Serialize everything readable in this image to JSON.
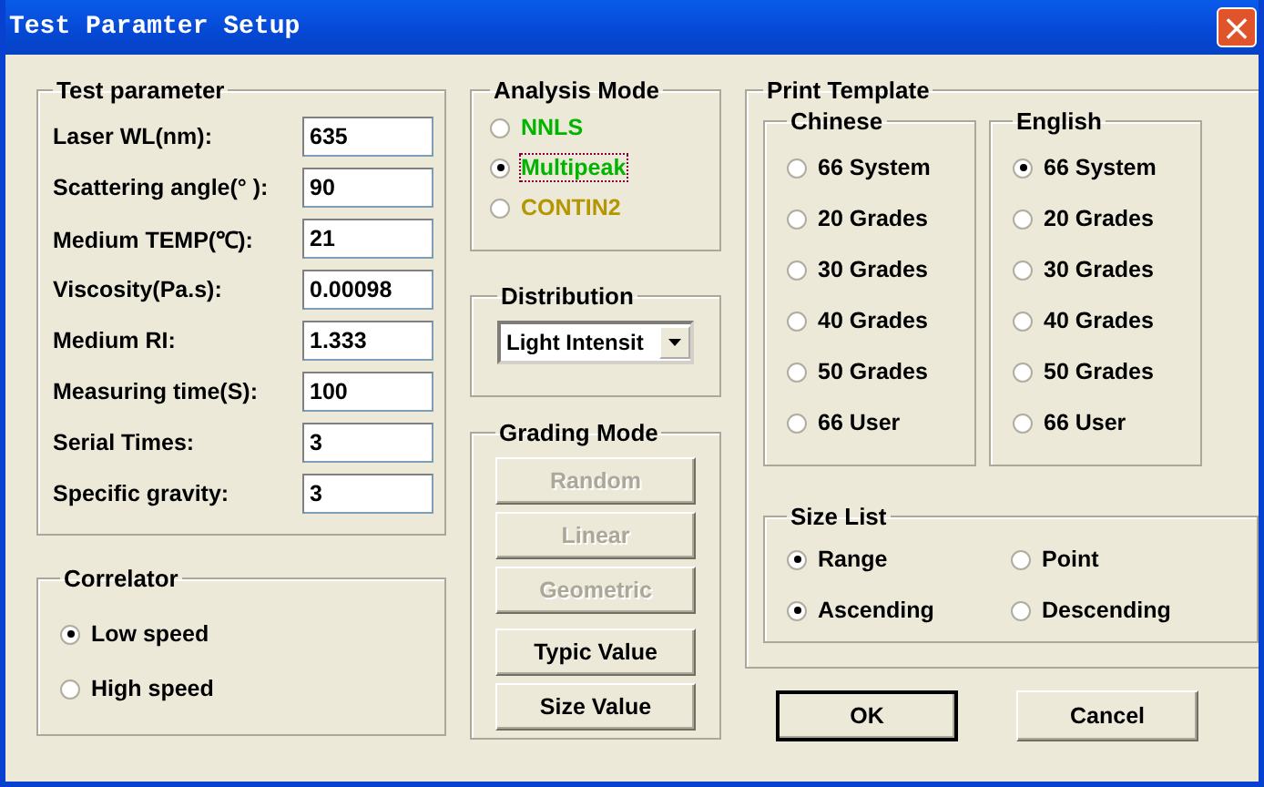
{
  "window": {
    "title": "Test Paramter Setup",
    "close": "×"
  },
  "test_parameter": {
    "title": "Test parameter",
    "fields": [
      {
        "label": "Laser WL(nm):",
        "value": "635"
      },
      {
        "label": "Scattering angle(°  ):",
        "value": "90"
      },
      {
        "label": "Medium TEMP(℃):",
        "value": "21"
      },
      {
        "label": "Viscosity(Pa.s):",
        "value": "0.00098"
      },
      {
        "label": "Medium RI:",
        "value": "1.333"
      },
      {
        "label": "Measuring time(S):",
        "value": "100"
      },
      {
        "label": "Serial Times:",
        "value": "3"
      },
      {
        "label": "Specific gravity:",
        "value": "3"
      }
    ]
  },
  "correlator": {
    "title": "Correlator",
    "options": [
      {
        "label": "Low speed",
        "selected": true
      },
      {
        "label": "High speed",
        "selected": false
      }
    ]
  },
  "analysis_mode": {
    "title": "Analysis Mode",
    "options": [
      {
        "label": "NNLS",
        "selected": false,
        "focused": false,
        "color": "#00b400"
      },
      {
        "label": "Multipeak",
        "selected": true,
        "focused": true,
        "color": "#00b400"
      },
      {
        "label": "CONTIN2",
        "selected": false,
        "focused": false,
        "color": "#b49600"
      }
    ]
  },
  "distribution": {
    "title": "Distribution",
    "value": "Light Intensit"
  },
  "grading_mode": {
    "title": "Grading Mode",
    "buttons": [
      {
        "label": "Random",
        "disabled": true
      },
      {
        "label": "Linear",
        "disabled": true
      },
      {
        "label": "Geometric",
        "disabled": true
      },
      {
        "label": "Typic Value",
        "disabled": false
      },
      {
        "label": "Size Value",
        "disabled": false
      }
    ]
  },
  "print_template": {
    "title": "Print Template",
    "groups": [
      {
        "title": "Chinese",
        "options": [
          {
            "label": "66 System",
            "selected": false
          },
          {
            "label": "20 Grades",
            "selected": false
          },
          {
            "label": "30 Grades",
            "selected": false
          },
          {
            "label": "40 Grades",
            "selected": false
          },
          {
            "label": "50 Grades",
            "selected": false
          },
          {
            "label": "66 User",
            "selected": false
          }
        ]
      },
      {
        "title": "English",
        "options": [
          {
            "label": "66 System",
            "selected": true
          },
          {
            "label": "20 Grades",
            "selected": false
          },
          {
            "label": "30 Grades",
            "selected": false
          },
          {
            "label": "40 Grades",
            "selected": false
          },
          {
            "label": "50 Grades",
            "selected": false
          },
          {
            "label": "66 User",
            "selected": false
          }
        ]
      }
    ]
  },
  "size_list": {
    "title": "Size List",
    "rows": [
      [
        {
          "label": "Range",
          "selected": true
        },
        {
          "label": "Point",
          "selected": false
        }
      ],
      [
        {
          "label": "Ascending",
          "selected": true
        },
        {
          "label": "Descending",
          "selected": false
        }
      ]
    ]
  },
  "buttons": [
    {
      "label": "OK",
      "default": true
    },
    {
      "label": "Cancel",
      "default": false
    }
  ]
}
